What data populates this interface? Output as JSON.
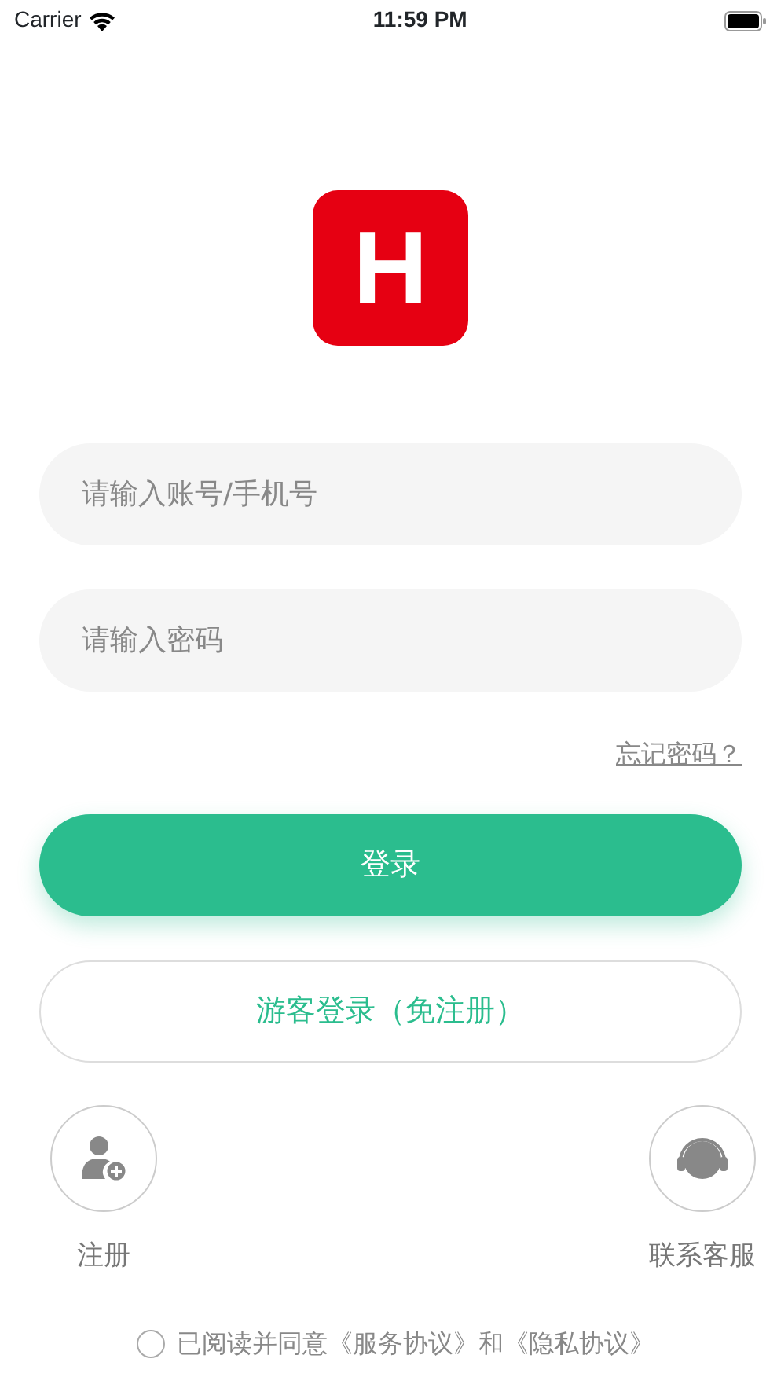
{
  "status_bar": {
    "carrier": "Carrier",
    "time": "11:59 PM"
  },
  "logo": {
    "letter": "H"
  },
  "fields": [
    {
      "placeholder": "请输入账号/手机号"
    },
    {
      "placeholder": "请输入密码"
    }
  ],
  "forgot_link": "忘记密码？",
  "login_button": "登录",
  "guest_button": "游客登录（免注册）",
  "shortcuts": [
    {
      "kind": "register",
      "label": "注册"
    },
    {
      "kind": "support",
      "label": "联系客服"
    }
  ],
  "agreement": {
    "checked": false,
    "text": "已阅读并同意《服务协议》和《隐私协议》"
  }
}
